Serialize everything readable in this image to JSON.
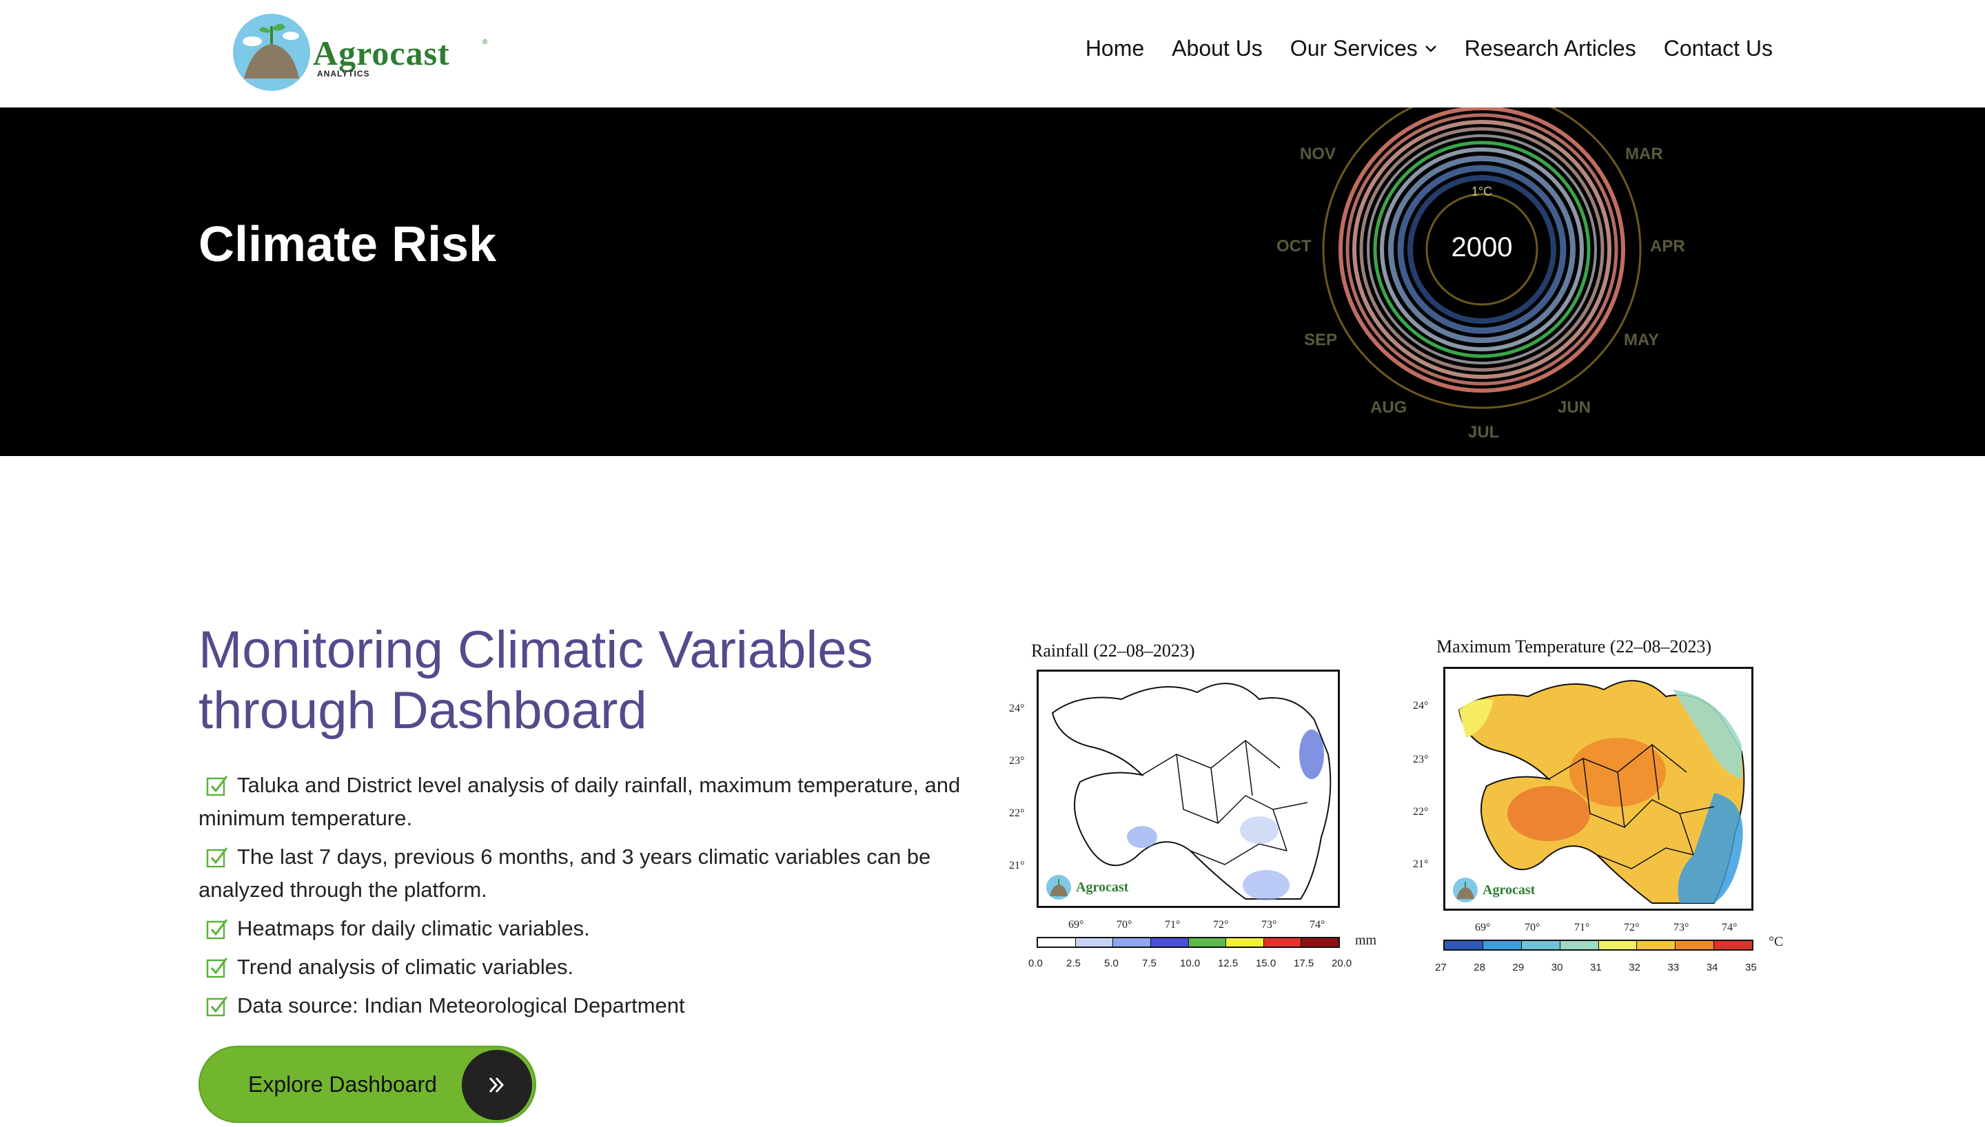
{
  "brand": {
    "name": "Agrocast",
    "sub": "ANALYTICS",
    "reg": "®"
  },
  "nav": [
    {
      "label": "Home"
    },
    {
      "label": "About Us"
    },
    {
      "label": "Our Services"
    },
    {
      "label": "Research Articles"
    },
    {
      "label": "Contact Us"
    }
  ],
  "hero": {
    "title": "Climate Risk",
    "spiral_year": "2000",
    "spiral_ring_label": "1°C",
    "months": [
      "NOV",
      "MAR",
      "OCT",
      "APR",
      "SEP",
      "MAY",
      "AUG",
      "JUN",
      "JUL"
    ]
  },
  "section": {
    "title": "Monitoring Climatic Variables through Dashboard",
    "features": [
      "Taluka and District level analysis of daily rainfall, maximum temperature, and minimum temperature.",
      "The last 7 days, previous 6 months, and 3 years climatic variables can be analyzed through the platform.",
      "Heatmaps for daily climatic variables.",
      "Trend analysis of climatic variables.",
      "Data source: Indian Meteorological Department"
    ],
    "button_label": "Explore Dashboard"
  },
  "maps": [
    {
      "title": "Rainfall (22–08–2023)",
      "lat_ticks": [
        "24°",
        "23°",
        "22°",
        "21°"
      ],
      "lon_ticks": [
        "69°",
        "70°",
        "71°",
        "72°",
        "73°",
        "74°"
      ],
      "unit": "mm",
      "colorbar_ticks": [
        "0.0",
        "2.5",
        "5.0",
        "7.5",
        "10.0",
        "12.5",
        "15.0",
        "17.5",
        "20.0"
      ],
      "colorbar_colors": [
        "#ffffff",
        "#c6d3f5",
        "#8ea6f0",
        "#4b4ed6",
        "#5cb84a",
        "#f2f03a",
        "#e3322a",
        "#8e1212"
      ],
      "logo_text": "Agrocast"
    },
    {
      "title": "Maximum Temperature (22–08–2023)",
      "lat_ticks": [
        "24°",
        "23°",
        "22°",
        "21°"
      ],
      "lon_ticks": [
        "69°",
        "70°",
        "71°",
        "72°",
        "73°",
        "74°"
      ],
      "unit": "°C",
      "colorbar_ticks": [
        "27",
        "28",
        "29",
        "30",
        "31",
        "32",
        "33",
        "34",
        "35"
      ],
      "colorbar_colors": [
        "#2f58b8",
        "#3c9ddc",
        "#6dc3d9",
        "#9fd9c5",
        "#f2ef6a",
        "#f5c542",
        "#ef8a2c",
        "#d6362b"
      ],
      "logo_text": "Agrocast"
    }
  ]
}
